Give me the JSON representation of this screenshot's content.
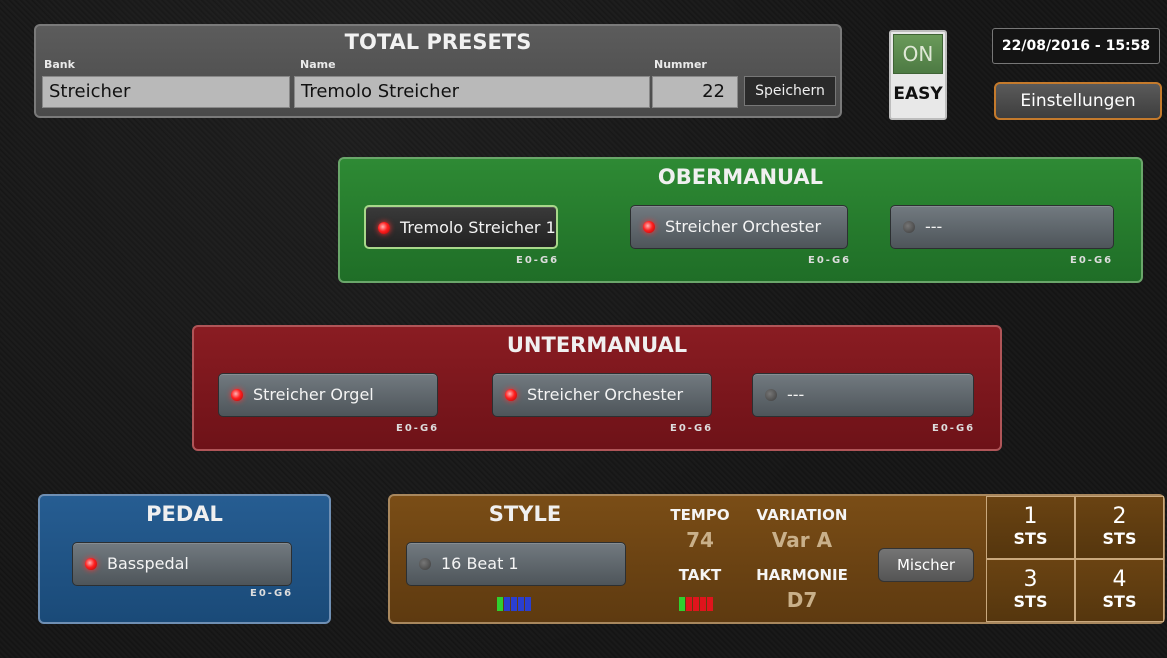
{
  "presets": {
    "title": "TOTAL PRESETS",
    "bank_label": "Bank",
    "bank_value": "Streicher",
    "name_label": "Name",
    "name_value": "Tremolo Streicher",
    "number_label": "Nummer",
    "number_value": "22",
    "save_label": "Speichern"
  },
  "easy": {
    "on_label": "ON",
    "easy_label": "EASY"
  },
  "datetime": "22/08/2016 - 15:58",
  "settings_label": "Einstellungen",
  "upper_manual": {
    "title": "OBERMANUAL",
    "voices": [
      {
        "label": "Tremolo Streicher 1",
        "range": "E0-G6",
        "active": true,
        "selected": true
      },
      {
        "label": "Streicher Orchester",
        "range": "E0-G6",
        "active": true,
        "selected": false
      },
      {
        "label": "---",
        "range": "E0-G6",
        "active": false,
        "selected": false
      }
    ]
  },
  "lower_manual": {
    "title": "UNTERMANUAL",
    "voices": [
      {
        "label": "Streicher Orgel",
        "range": "E0-G6",
        "active": true
      },
      {
        "label": "Streicher Orchester",
        "range": "E0-G6",
        "active": true
      },
      {
        "label": "---",
        "range": "E0-G6",
        "active": false
      }
    ]
  },
  "pedal": {
    "title": "PEDAL",
    "voice": {
      "label": "Basspedal",
      "range": "E0-G6",
      "active": true
    }
  },
  "style": {
    "title": "STYLE",
    "style_name": "16 Beat 1",
    "tempo_label": "TEMPO",
    "tempo_value": "74",
    "variation_label": "VARIATION",
    "variation_value": "Var A",
    "takt_label": "TAKT",
    "harmonie_label": "HARMONIE",
    "harmonie_value": "D7",
    "mixer_label": "Mischer",
    "sts": [
      {
        "num": "1",
        "label": "STS"
      },
      {
        "num": "2",
        "label": "STS"
      },
      {
        "num": "3",
        "label": "STS"
      },
      {
        "num": "4",
        "label": "STS"
      }
    ],
    "colors": {
      "led_active": "#ff2020",
      "style_bar_green": "#2fd02f",
      "style_bar_blue": "#2a3fd0",
      "takt_red": "#e0141c"
    }
  }
}
